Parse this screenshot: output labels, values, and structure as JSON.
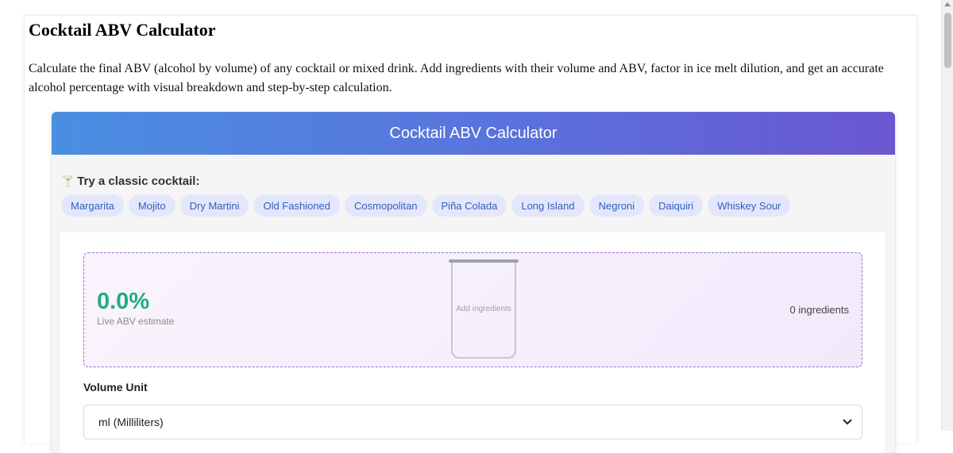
{
  "page": {
    "title": "Cocktail ABV Calculator",
    "description": "Calculate the final ABV (alcohol by volume) of any cocktail or mixed drink. Add ingredients with their volume and ABV, factor in ice melt dilution, and get an accurate alcohol percentage with visual breakdown and step-by-step calculation."
  },
  "calculator": {
    "header_title": "Cocktail ABV Calculator",
    "presets_label": "Try a classic cocktail:",
    "presets_icon": "cocktail-glass-icon",
    "presets": [
      "Margarita",
      "Mojito",
      "Dry Martini",
      "Old Fashioned",
      "Cosmopolitan",
      "Piña Colada",
      "Long Island",
      "Negroni",
      "Daiquiri",
      "Whiskey Sour"
    ],
    "preview": {
      "abv": "0.0%",
      "abv_caption": "Live ABV estimate",
      "glass_text": "Add ingredients",
      "ingredient_count": "0 ingredients"
    },
    "volume_unit": {
      "label": "Volume Unit",
      "selected": "ml (Milliliters)"
    }
  },
  "colors": {
    "header_gradient_start": "#4a8fe2",
    "header_gradient_end": "#6a57cf",
    "abv_green": "#1fae7a",
    "chip_bg": "#e4e7fb",
    "chip_text": "#2f5fbf",
    "preview_border": "#9b6dd6"
  }
}
